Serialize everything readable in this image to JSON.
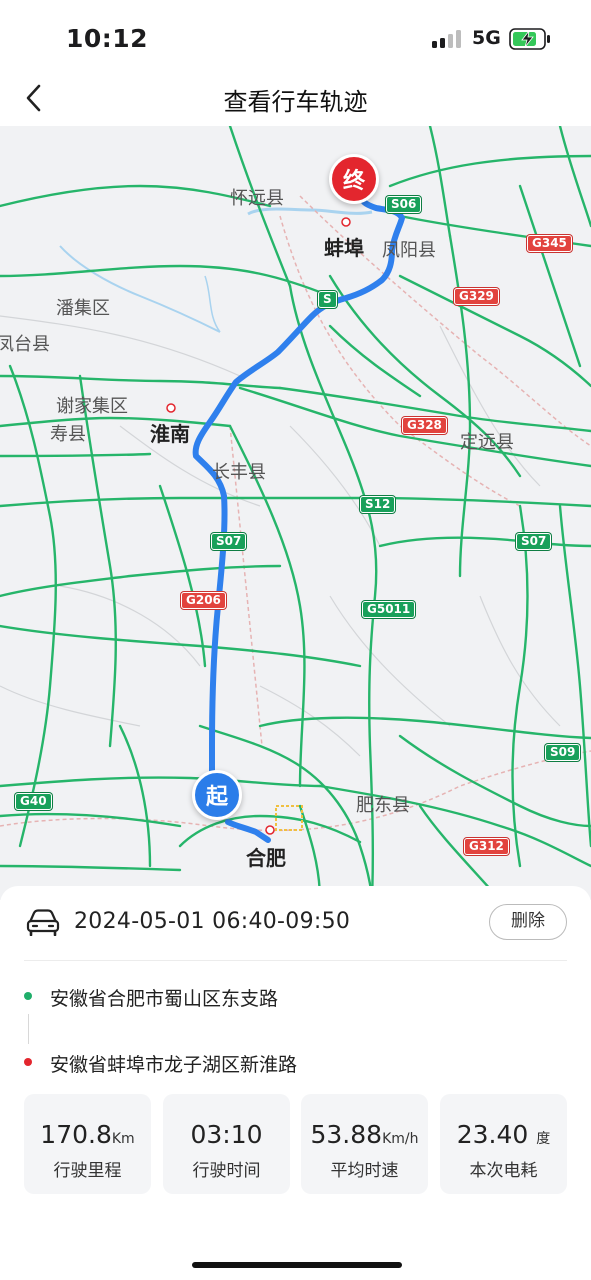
{
  "status_bar": {
    "time": "10:12",
    "network": "5G",
    "battery_charging": true
  },
  "nav": {
    "back_icon": "chevron-left-icon",
    "title": "查看行车轨迹"
  },
  "map": {
    "end_marker": "终",
    "start_marker": "起",
    "route_color": "#2f80ed",
    "labels": {
      "huaiyuan": "怀远县",
      "bengbu": "蚌埠",
      "fengyang": "凤阳县",
      "panji": "潘集区",
      "fengtai": "凤台县",
      "xiejiaji": "谢家集区",
      "shouxian": "寿县",
      "huainan": "淮南",
      "changfeng": "长丰县",
      "dingyuan": "定远县",
      "feidong": "肥东县",
      "hefei": "合肥"
    },
    "shields": {
      "s06": "S06",
      "g345": "G345",
      "g329": "G329",
      "s_near_bengbu": "S",
      "g328": "G328",
      "s12": "S12",
      "s07_left": "S07",
      "s07_right": "S07",
      "g206": "G206",
      "g5011": "G5011",
      "s09": "S09",
      "g40": "G40",
      "g312": "G312"
    }
  },
  "trip": {
    "time_range": "2024-05-01 06:40-09:50",
    "delete_label": "删除",
    "start_address": "安徽省合肥市蜀山区东支路",
    "end_address": "安徽省蚌埠市龙子湖区新淮路",
    "start_color": "#1fae6a",
    "end_color": "#e3262e"
  },
  "stats": [
    {
      "value": "170.8",
      "unit": "Km",
      "label": "行驶里程"
    },
    {
      "value": "03:10",
      "unit": "",
      "label": "行驶时间"
    },
    {
      "value": "53.88",
      "unit": "Km/h",
      "label": "平均时速"
    },
    {
      "value": "23.40",
      "unit": "度",
      "label": "本次电耗"
    }
  ]
}
